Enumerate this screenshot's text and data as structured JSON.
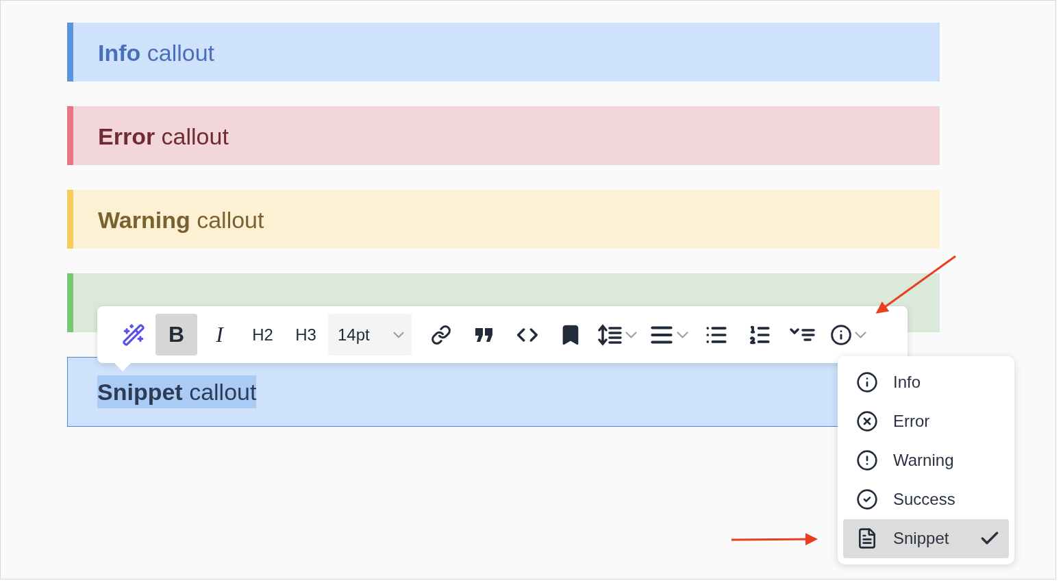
{
  "callouts": [
    {
      "kind": "info",
      "title": "Info",
      "text": "callout"
    },
    {
      "kind": "error",
      "title": "Error",
      "text": "callout"
    },
    {
      "kind": "warning",
      "title": "Warning",
      "text": "callout"
    },
    {
      "kind": "success"
    },
    {
      "kind": "snippet",
      "title": "Snippet",
      "text": "callout",
      "highlighted": true
    }
  ],
  "toolbar": {
    "format_buttons": [
      {
        "label": "B",
        "selected": true
      },
      {
        "label": "I",
        "selected": false
      },
      {
        "label": "H2",
        "selected": false
      },
      {
        "label": "H3",
        "selected": false
      }
    ],
    "font_size": {
      "value": "14pt"
    }
  },
  "callout_menu": {
    "items": [
      {
        "kind": "info",
        "label": "Info",
        "selected": false
      },
      {
        "kind": "error",
        "label": "Error",
        "selected": false
      },
      {
        "kind": "warning",
        "label": "Warning",
        "selected": false
      },
      {
        "kind": "success",
        "label": "Success",
        "selected": false
      },
      {
        "kind": "snippet",
        "label": "Snippet",
        "selected": true
      }
    ]
  }
}
